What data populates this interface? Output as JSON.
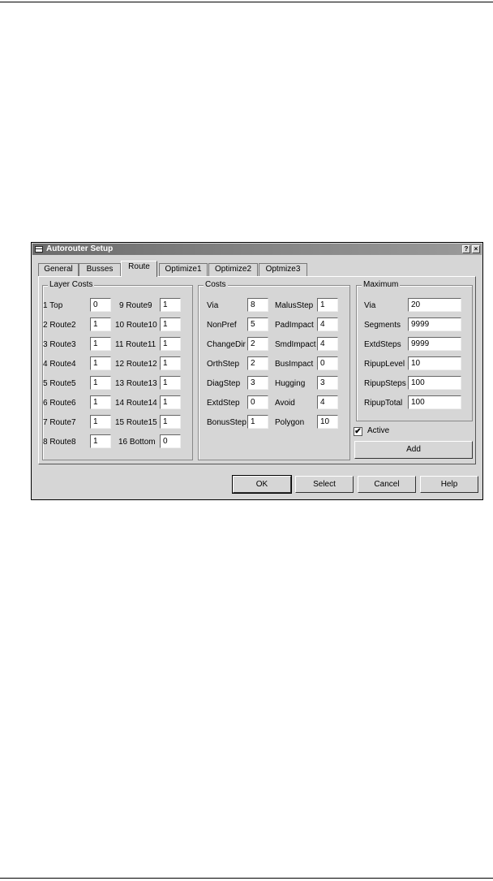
{
  "dialog": {
    "title": "Autorouter Setup",
    "help_glyph": "?",
    "close_glyph": "×",
    "tabs": [
      "General",
      "Busses",
      "Route",
      "Optimize1",
      "Optimize2",
      "Optmize3"
    ],
    "active_tab": "Route"
  },
  "layer_costs": {
    "title": "Layer Costs",
    "rows": [
      {
        "label": "1 Top",
        "value": "0"
      },
      {
        "label": "2 Route2",
        "value": "1"
      },
      {
        "label": "3 Route3",
        "value": "1"
      },
      {
        "label": "4 Route4",
        "value": "1"
      },
      {
        "label": "5 Route5",
        "value": "1"
      },
      {
        "label": "6 Route6",
        "value": "1"
      },
      {
        "label": "7 Route7",
        "value": "1"
      },
      {
        "label": "8 Route8",
        "value": "1"
      },
      {
        "label": "9 Route9",
        "value": "1"
      },
      {
        "label": "10 Route10",
        "value": "1"
      },
      {
        "label": "11 Route11",
        "value": "1"
      },
      {
        "label": "12 Route12",
        "value": "1"
      },
      {
        "label": "13 Route13",
        "value": "1"
      },
      {
        "label": "14 Route14",
        "value": "1"
      },
      {
        "label": "15 Route15",
        "value": "1"
      },
      {
        "label": "16 Bottom",
        "value": "0"
      }
    ]
  },
  "costs": {
    "title": "Costs",
    "rows": [
      {
        "label": "Via",
        "value": "8"
      },
      {
        "label": "NonPref",
        "value": "5"
      },
      {
        "label": "ChangeDir",
        "value": "2"
      },
      {
        "label": "OrthStep",
        "value": "2"
      },
      {
        "label": "DiagStep",
        "value": "3"
      },
      {
        "label": "ExtdStep",
        "value": "0"
      },
      {
        "label": "BonusStep",
        "value": "1"
      },
      {
        "label": "MalusStep",
        "value": "1"
      },
      {
        "label": "PadImpact",
        "value": "4"
      },
      {
        "label": "SmdImpact",
        "value": "4"
      },
      {
        "label": "BusImpact",
        "value": "0"
      },
      {
        "label": "Hugging",
        "value": "3"
      },
      {
        "label": "Avoid",
        "value": "4"
      },
      {
        "label": "Polygon",
        "value": "10"
      }
    ]
  },
  "maximum": {
    "title": "Maximum",
    "rows": [
      {
        "label": "Via",
        "value": "20"
      },
      {
        "label": "Segments",
        "value": "9999"
      },
      {
        "label": "ExtdSteps",
        "value": "9999"
      },
      {
        "label": "RipupLevel",
        "value": "10"
      },
      {
        "label": "RipupSteps",
        "value": "100"
      },
      {
        "label": "RipupTotal",
        "value": "100"
      }
    ],
    "active_label": "Active",
    "active_checked": true,
    "add_label": "Add"
  },
  "buttons": {
    "ok": "OK",
    "select": "Select",
    "cancel": "Cancel",
    "help": "Help"
  }
}
